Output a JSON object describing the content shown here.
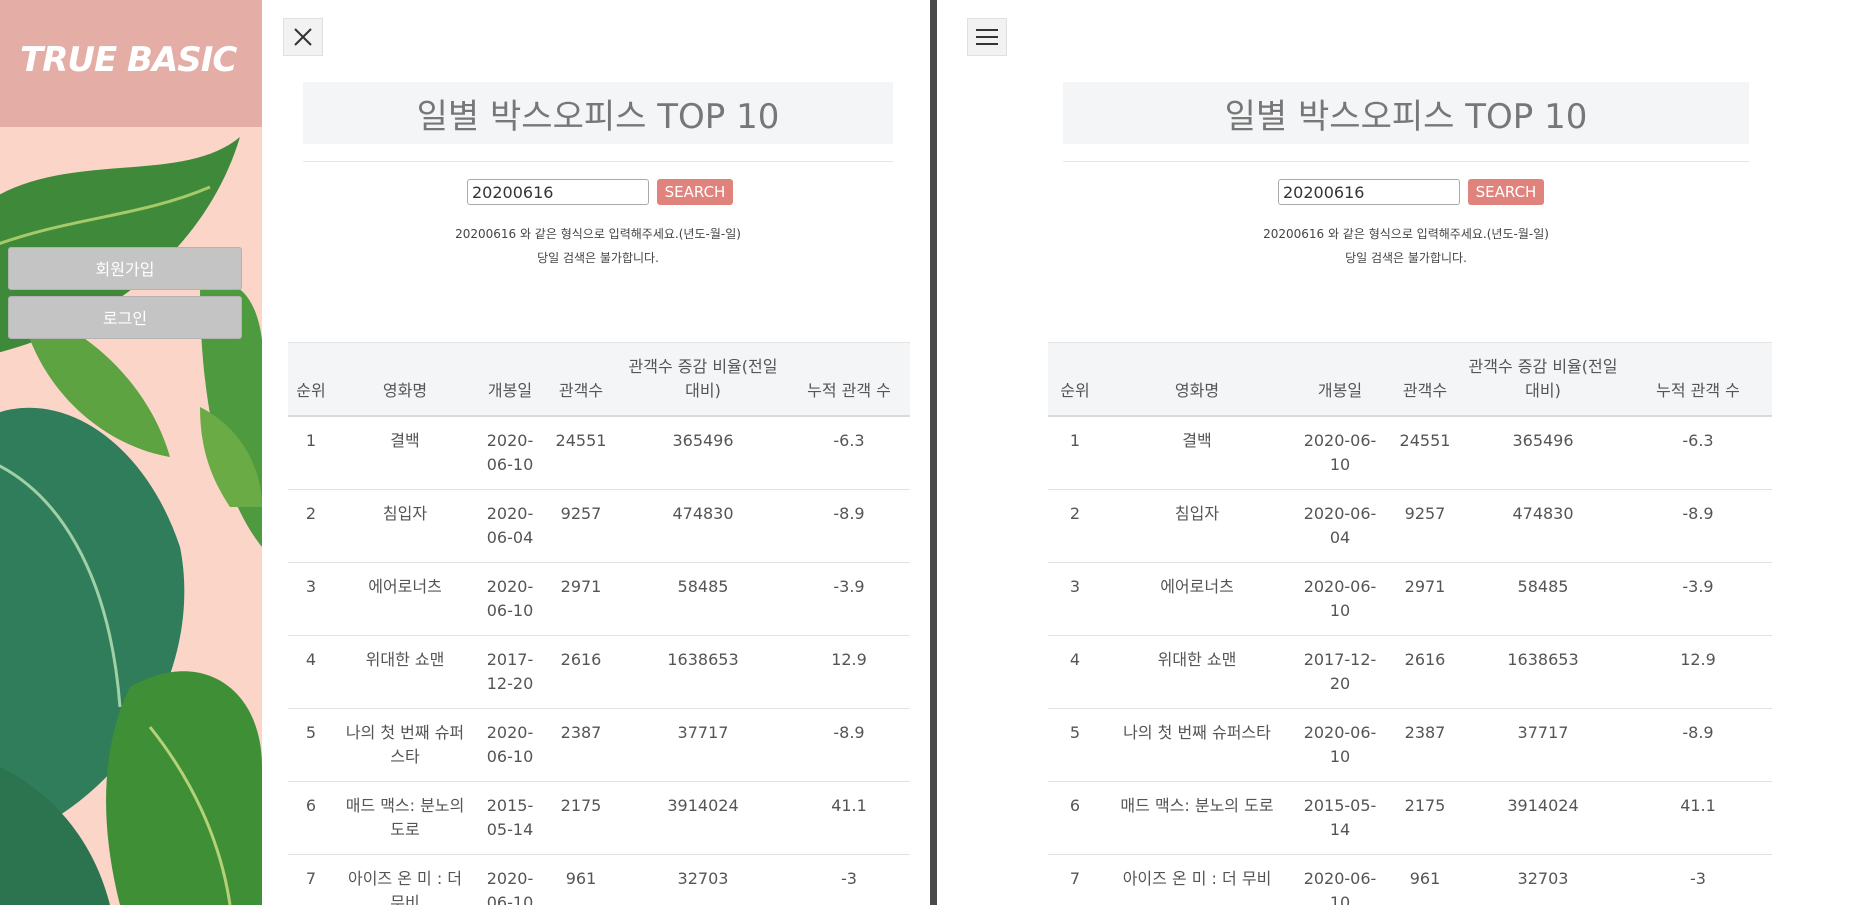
{
  "sidebar": {
    "brand": "TRUE BASIC",
    "signup_label": "회원가입",
    "login_label": "로그인"
  },
  "page": {
    "title": "일별 박스오피스 TOP 10",
    "search_value": "20200616",
    "search_button": "SEARCH",
    "hint_line1": "20200616 와 같은 형식으로 입력해주세요.(년도-월-일)",
    "hint_line2": "당일 검색은 불가합니다."
  },
  "table": {
    "headers": [
      "순위",
      "영화명",
      "개봉일",
      "관객수",
      "관객수 증감 비율(전일대비)",
      "누적 관객 수"
    ],
    "rows": [
      [
        "1",
        "결백",
        "2020-06-10",
        "24551",
        "365496",
        "-6.3"
      ],
      [
        "2",
        "침입자",
        "2020-06-04",
        "9257",
        "474830",
        "-8.9"
      ],
      [
        "3",
        "에어로너츠",
        "2020-06-10",
        "2971",
        "58485",
        "-3.9"
      ],
      [
        "4",
        "위대한 쇼맨",
        "2017-12-20",
        "2616",
        "1638653",
        "12.9"
      ],
      [
        "5",
        "나의 첫 번째 슈퍼스타",
        "2020-06-10",
        "2387",
        "37717",
        "-8.9"
      ],
      [
        "6",
        "매드 맥스: 분노의 도로",
        "2015-05-14",
        "2175",
        "3914024",
        "41.1"
      ],
      [
        "7",
        "아이즈 온 미 : 더 무비",
        "2020-06-10",
        "961",
        "32703",
        "-3"
      ]
    ]
  },
  "icons": {
    "close": "close-icon",
    "menu": "hamburger-menu-icon"
  },
  "colors": {
    "brand_bg": "#e4ada6",
    "sidebar_bg": "#fcd5c9",
    "search_button": "#e0837d",
    "divider": "#4a4a4a"
  }
}
